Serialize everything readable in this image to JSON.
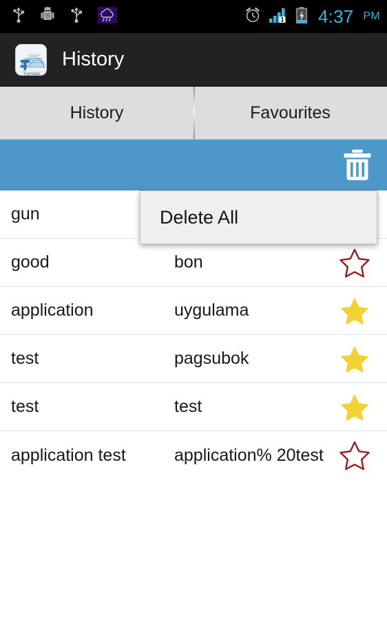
{
  "status_bar": {
    "icons_left": [
      "usb-icon",
      "android-debug-icon",
      "usb-icon",
      "weather-rain-icon"
    ],
    "icons_right": [
      "alarm-clock-icon",
      "signal-bars-icon",
      "battery-charging-icon"
    ],
    "signal_badge": "1",
    "time": "4:37",
    "ampm": "PM",
    "time_color": "#33b5e5",
    "background": "#000000"
  },
  "action_bar": {
    "app_icon": "translate-globe-icon",
    "title": "History",
    "background": "#222222"
  },
  "tabs": [
    {
      "label": "History",
      "selected": true,
      "name": "tab-history"
    },
    {
      "label": "Favourites",
      "selected": false,
      "name": "tab-favourites"
    }
  ],
  "toolbar": {
    "background": "#4d97c9",
    "delete_icon": "trash-icon",
    "delete_icon_label": "Delete"
  },
  "popup_menu": {
    "visible": true,
    "items": [
      {
        "label": "Delete All",
        "name": "menu-item-delete-all"
      }
    ],
    "background": "#efefef"
  },
  "colors": {
    "star_filled": "#f5d033",
    "star_outline": "#9e1a1a",
    "accent_blue": "#4d97c9",
    "row_divider": "#e2e2e2",
    "tab_background": "#dddddd"
  },
  "list": {
    "rows": [
      {
        "source": "gun",
        "target": "",
        "favourite": true
      },
      {
        "source": "good",
        "target": "bon",
        "favourite": false
      },
      {
        "source": "application",
        "target": "uygulama",
        "favourite": true
      },
      {
        "source": "test",
        "target": "pagsubok",
        "favourite": true
      },
      {
        "source": "test",
        "target": "test",
        "favourite": true
      },
      {
        "source": "application test",
        "target": "application% 20test",
        "favourite": false
      }
    ]
  }
}
